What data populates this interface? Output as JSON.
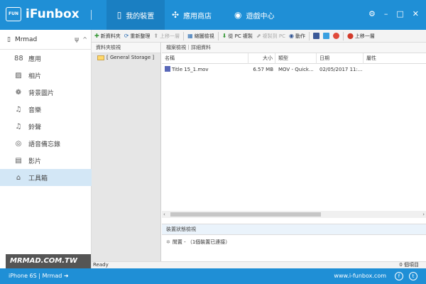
{
  "app": {
    "logo": "FUN",
    "name": "iFunbox"
  },
  "tabs": [
    {
      "label": "我的裝置",
      "icon": "phone-icon",
      "active": true
    },
    {
      "label": "應用商店",
      "icon": "apps-icon"
    },
    {
      "label": "遊戲中心",
      "icon": "gamepad-icon"
    }
  ],
  "window_controls": {
    "settings": "⚙",
    "minimize": "–",
    "maximize": "□",
    "close": "✕"
  },
  "device": {
    "name": "Mrmad",
    "usb": "ψ",
    "chevron": "^"
  },
  "sidebar": {
    "items": [
      {
        "label": "應用",
        "icon": "apps-grid-icon",
        "glyph": "88"
      },
      {
        "label": "相片",
        "icon": "photo-icon",
        "glyph": "▨"
      },
      {
        "label": "背景圖片",
        "icon": "wallpaper-icon",
        "glyph": "❁"
      },
      {
        "label": "音樂",
        "icon": "music-icon",
        "glyph": "♫"
      },
      {
        "label": "鈴聲",
        "icon": "bell-icon",
        "glyph": "♫"
      },
      {
        "label": "語音備忘錄",
        "icon": "voice-memo-icon",
        "glyph": "◎"
      },
      {
        "label": "影片",
        "icon": "video-icon",
        "glyph": "▤"
      },
      {
        "label": "工具箱",
        "icon": "toolbox-icon",
        "glyph": "⌂",
        "active": true
      }
    ]
  },
  "watermark": "MRMAD.COM.TW",
  "toolbar": {
    "new_folder": "新資料夾",
    "refresh": "重新整理",
    "up": "上移一層",
    "thumbnail": "縮圖檢視",
    "copy_from_pc": "從 PC 複製",
    "copy_to_pc": "複製到 PC",
    "action": "動作",
    "prev": "上移一層"
  },
  "folder_panel": {
    "header": "資料夾檢視",
    "item": "[ General Storage ]"
  },
  "file_panel": {
    "header": "檔案檢視｜詳細資料",
    "columns": {
      "name": "名稱",
      "size": "大小",
      "type": "類型",
      "date": "日期",
      "attrs": "屬性"
    },
    "rows": [
      {
        "name": "Title 15_1.mov",
        "size": "6.57 MB",
        "type": "MOV - Quick...",
        "date": "02/05/2017 11:..."
      }
    ]
  },
  "info_panel": {
    "header": "裝置狀態檢視",
    "line": "閒置 - （1個裝置已連接）"
  },
  "status": {
    "left": "Ready",
    "right": "0 個項目"
  },
  "bottom": {
    "device": "iPhone 6S | Mrmad",
    "arrow": "➜",
    "site": "www.i-funbox.com",
    "facebook": "f",
    "twitter": "t"
  },
  "colors": {
    "primary": "#1f8fd6",
    "active_tab": "#1a7fc2",
    "selected": "#d3e7f6"
  }
}
